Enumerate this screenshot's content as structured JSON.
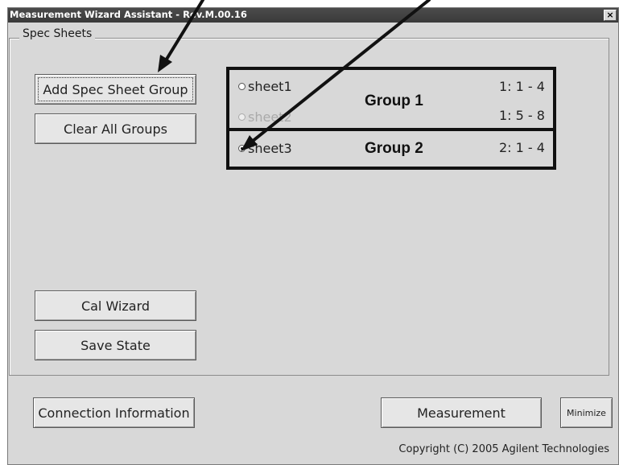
{
  "window": {
    "title": "Measurement Wizard Assistant - Rev.M.00.16",
    "close_label": "×"
  },
  "spec_sheets": {
    "legend": "Spec Sheets",
    "add_group_label": "Add Spec Sheet Group",
    "clear_groups_label": "Clear All Groups",
    "cal_wizard_label": "Cal Wizard",
    "save_state_label": "Save State",
    "sheets": [
      {
        "name": "sheet1",
        "range": "1: 1 - 4",
        "checked": false,
        "enabled": true
      },
      {
        "name": "sheet2",
        "range": "1: 5 - 8",
        "checked": false,
        "enabled": false
      },
      {
        "name": "sheet3",
        "range": "2: 1 - 4",
        "checked": true,
        "enabled": true
      }
    ],
    "group_labels": [
      "Group 1",
      "Group 2"
    ]
  },
  "footer": {
    "connection_label": "Connection Information",
    "measurement_label": "Measurement",
    "minimize_label": "Minimize",
    "copyright": "Copyright (C) 2005 Agilent Technologies"
  }
}
